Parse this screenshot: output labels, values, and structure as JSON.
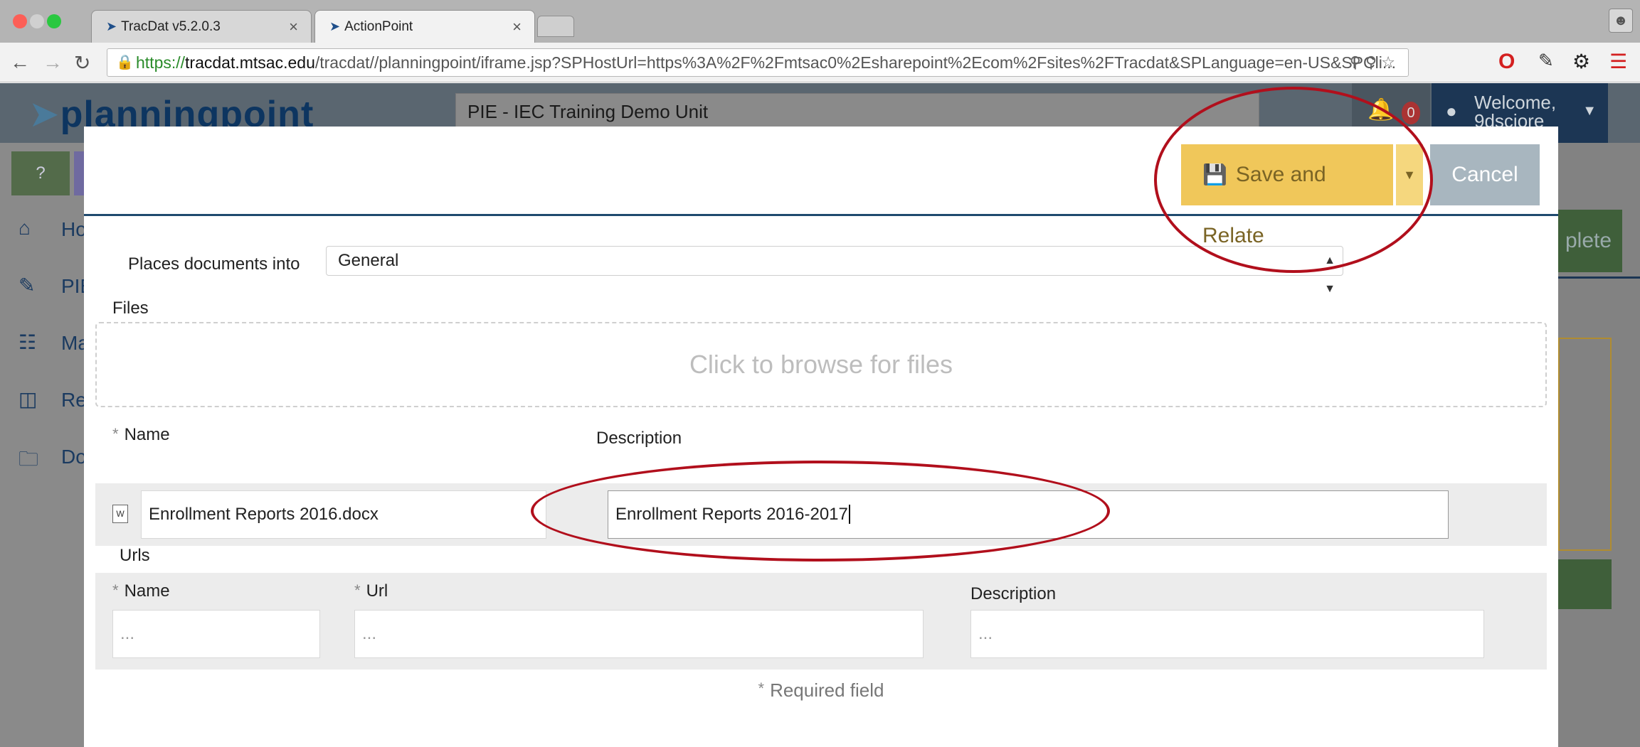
{
  "browser": {
    "tabs": [
      {
        "label": "TracDat v5.2.0.3",
        "close": "×"
      },
      {
        "label": "ActionPoint",
        "close": "×"
      }
    ],
    "url": {
      "scheme": "https://",
      "host": "tracdat.mtsac.edu",
      "path": "/tracdat//planningpoint/iframe.jsp?SPHostUrl=https%3A%2F%2Fmtsac0%2Esharepoint%2Ecom%2Fsites%2FTracdat&SPLanguage=en-US&SPCli..."
    }
  },
  "app": {
    "logo": "planningpoint",
    "unit_select": "PIE - IEC Training Demo Unit",
    "notifications_count": "0",
    "welcome": "Welcome,",
    "username": "9dsciore",
    "help_label": "?",
    "sidebar": [
      {
        "label": "Ho"
      },
      {
        "label": "PIE"
      },
      {
        "label": "Ma"
      },
      {
        "label": "Re"
      },
      {
        "label": "Do"
      }
    ],
    "right_button_partial": "plete"
  },
  "modal": {
    "save_label": "Save and Relate",
    "cancel_label": "Cancel",
    "places_label": "Places documents into",
    "places_value": "General",
    "files_label": "Files",
    "dropzone_text": "Click to browse for files",
    "file_columns": {
      "name": "Name",
      "description": "Description"
    },
    "file": {
      "name": "Enrollment Reports 2016.docx",
      "description": "Enrollment Reports 2016-2017"
    },
    "urls_label": "Urls",
    "url_columns": {
      "name": "Name",
      "url": "Url",
      "description": "Description"
    },
    "url_placeholders": {
      "name": "...",
      "url": "...",
      "description": "..."
    },
    "required_note": "Required field",
    "required_star": "*"
  },
  "colors": {
    "annotation": "#b10f1c",
    "save_button": "#f0c75a",
    "cancel_button": "#a8b6bf",
    "header_navy": "#1c3654"
  }
}
